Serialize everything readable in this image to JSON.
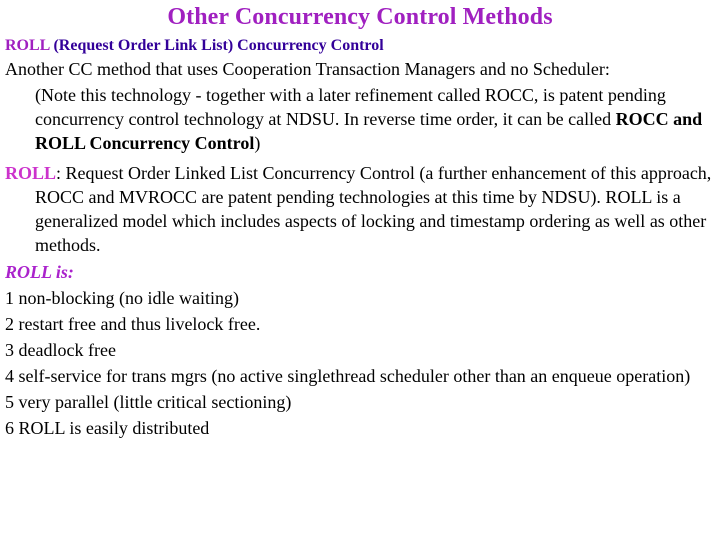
{
  "slide": {
    "title": "Other Concurrency Control Methods",
    "title_color": "#A020C0",
    "background_color": "#FFFFFF",
    "heading": {
      "roll_part": "ROLL",
      "roll_part_color": "#A020C0",
      "rest": " (Request Order Link List) Concurrency Control",
      "rest_color": "#330099"
    },
    "paragraph_1": {
      "line_1": "Another CC method that uses Cooperation Transaction Managers and no Scheduler:",
      "line_2": "(Note this technology - together with a later refinement called ROCC, is patent",
      "line_3": "pending concurrency control technology at NDSU. In reverse time order, it can be",
      "line_4_prefix": "called ",
      "line_4_bold": "ROCC and ROLL Concurrency Control",
      "line_4_suffix": ")"
    },
    "paragraph_2": {
      "roll_label": "ROLL",
      "roll_label_color": "#CC33CC",
      "text": ": Request Order Linked List Concurrency Control (a further enhancement of this approach, ROCC and MVROCC are patent pending technologies at this time by NDSU). ROLL is a generalized model which includes aspects of locking and timestamp ordering as well as other methods."
    },
    "roll_is_label": "ROLL is:",
    "roll_is_color": "#AA22CC",
    "numbered_items": [
      "1 non-blocking (no idle waiting)",
      "2 restart free and thus livelock free.",
      "3 deadlock free",
      "4 self-service for trans mgrs (no active singlethread scheduler other than an enqueue operation)",
      "5 very parallel (little critical sectioning)",
      "6 ROLL is easily distributed"
    ]
  }
}
